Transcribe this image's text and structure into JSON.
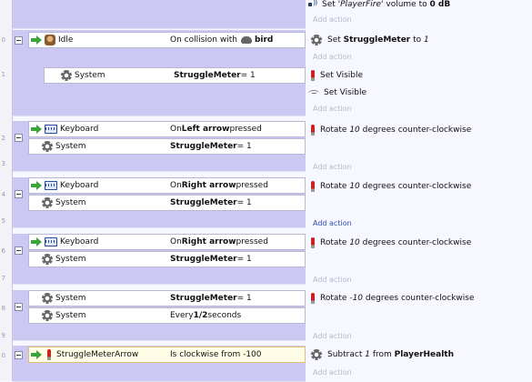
{
  "line_numbers": [
    "0",
    "1",
    "2",
    "3",
    "4",
    "5",
    "6",
    "7",
    "8",
    "9",
    "0"
  ],
  "top_action": {
    "prefix": "Set ",
    "name": "'PlayerFire'",
    "mid": " volume to ",
    "value": "0 dB"
  },
  "add_action_label": "Add action",
  "events": [
    {
      "id": "e1",
      "conditions": [
        {
          "object": "Idle",
          "pre": "On collision with ",
          "bold": "bird",
          "post": ""
        },
        {
          "object": "System",
          "pre": "",
          "bold": "StruggleMeter",
          "post": " = 1"
        }
      ],
      "actions": [
        {
          "icon": "gear-icon",
          "pre": "Set ",
          "bold": "StruggleMeter",
          "mid": " to ",
          "ital": "1",
          "post": ""
        },
        {
          "icon": "needle-icon",
          "pre": "Set Visible",
          "bold": "",
          "mid": "",
          "ital": "",
          "post": ""
        },
        {
          "icon": "eye-icon",
          "pre": "Set Visible",
          "bold": "",
          "mid": "",
          "ital": "",
          "post": ""
        }
      ]
    },
    {
      "id": "e2",
      "conditions": [
        {
          "object": "Keyboard",
          "pre": "On ",
          "bold": "Left arrow",
          "post": " pressed"
        },
        {
          "object": "System",
          "pre": "",
          "bold": "StruggleMeter",
          "post": " = 1"
        }
      ],
      "actions": [
        {
          "icon": "needle-icon",
          "pre": "Rotate ",
          "bold": "",
          "mid": "",
          "ital": "10",
          "post": " degrees counter-clockwise"
        }
      ]
    },
    {
      "id": "e3",
      "conditions": [
        {
          "object": "Keyboard",
          "pre": "On ",
          "bold": "Right arrow",
          "post": " pressed"
        },
        {
          "object": "System",
          "pre": "",
          "bold": "StruggleMeter",
          "post": " = 1"
        }
      ],
      "actions": [
        {
          "icon": "needle-icon",
          "pre": "Rotate ",
          "bold": "",
          "mid": "",
          "ital": "10",
          "post": " degrees counter-clockwise"
        }
      ]
    },
    {
      "id": "e4",
      "conditions": [
        {
          "object": "Keyboard",
          "pre": "On ",
          "bold": "Right arrow",
          "post": " pressed"
        },
        {
          "object": "System",
          "pre": "",
          "bold": "StruggleMeter",
          "post": " = 1"
        }
      ],
      "actions": [
        {
          "icon": "needle-icon",
          "pre": "Rotate ",
          "bold": "",
          "mid": "",
          "ital": "10",
          "post": " degrees counter-clockwise"
        }
      ]
    },
    {
      "id": "e5",
      "conditions": [
        {
          "object": "System",
          "pre": "",
          "bold": "StruggleMeter",
          "post": " = 1"
        },
        {
          "object": "System",
          "pre": "Every ",
          "bold": "1/2",
          "post": " seconds"
        }
      ],
      "actions": [
        {
          "icon": "needle-icon",
          "pre": "Rotate ",
          "bold": "",
          "mid": "",
          "ital": "-10",
          "post": " degrees counter-clockwise"
        }
      ]
    },
    {
      "id": "e6",
      "conditions": [
        {
          "object": "StruggleMeterArrow",
          "pre": "Is clockwise from -100",
          "bold": "",
          "post": ""
        }
      ],
      "actions": [
        {
          "icon": "gear-icon",
          "pre": "Subtract ",
          "bold": "",
          "mid": "",
          "ital": "1",
          "post": " from "
        },
        {
          "icon": "",
          "pre": "",
          "bold": "PlayerHealth",
          "mid": "",
          "ital": "",
          "post": ""
        }
      ]
    }
  ]
}
